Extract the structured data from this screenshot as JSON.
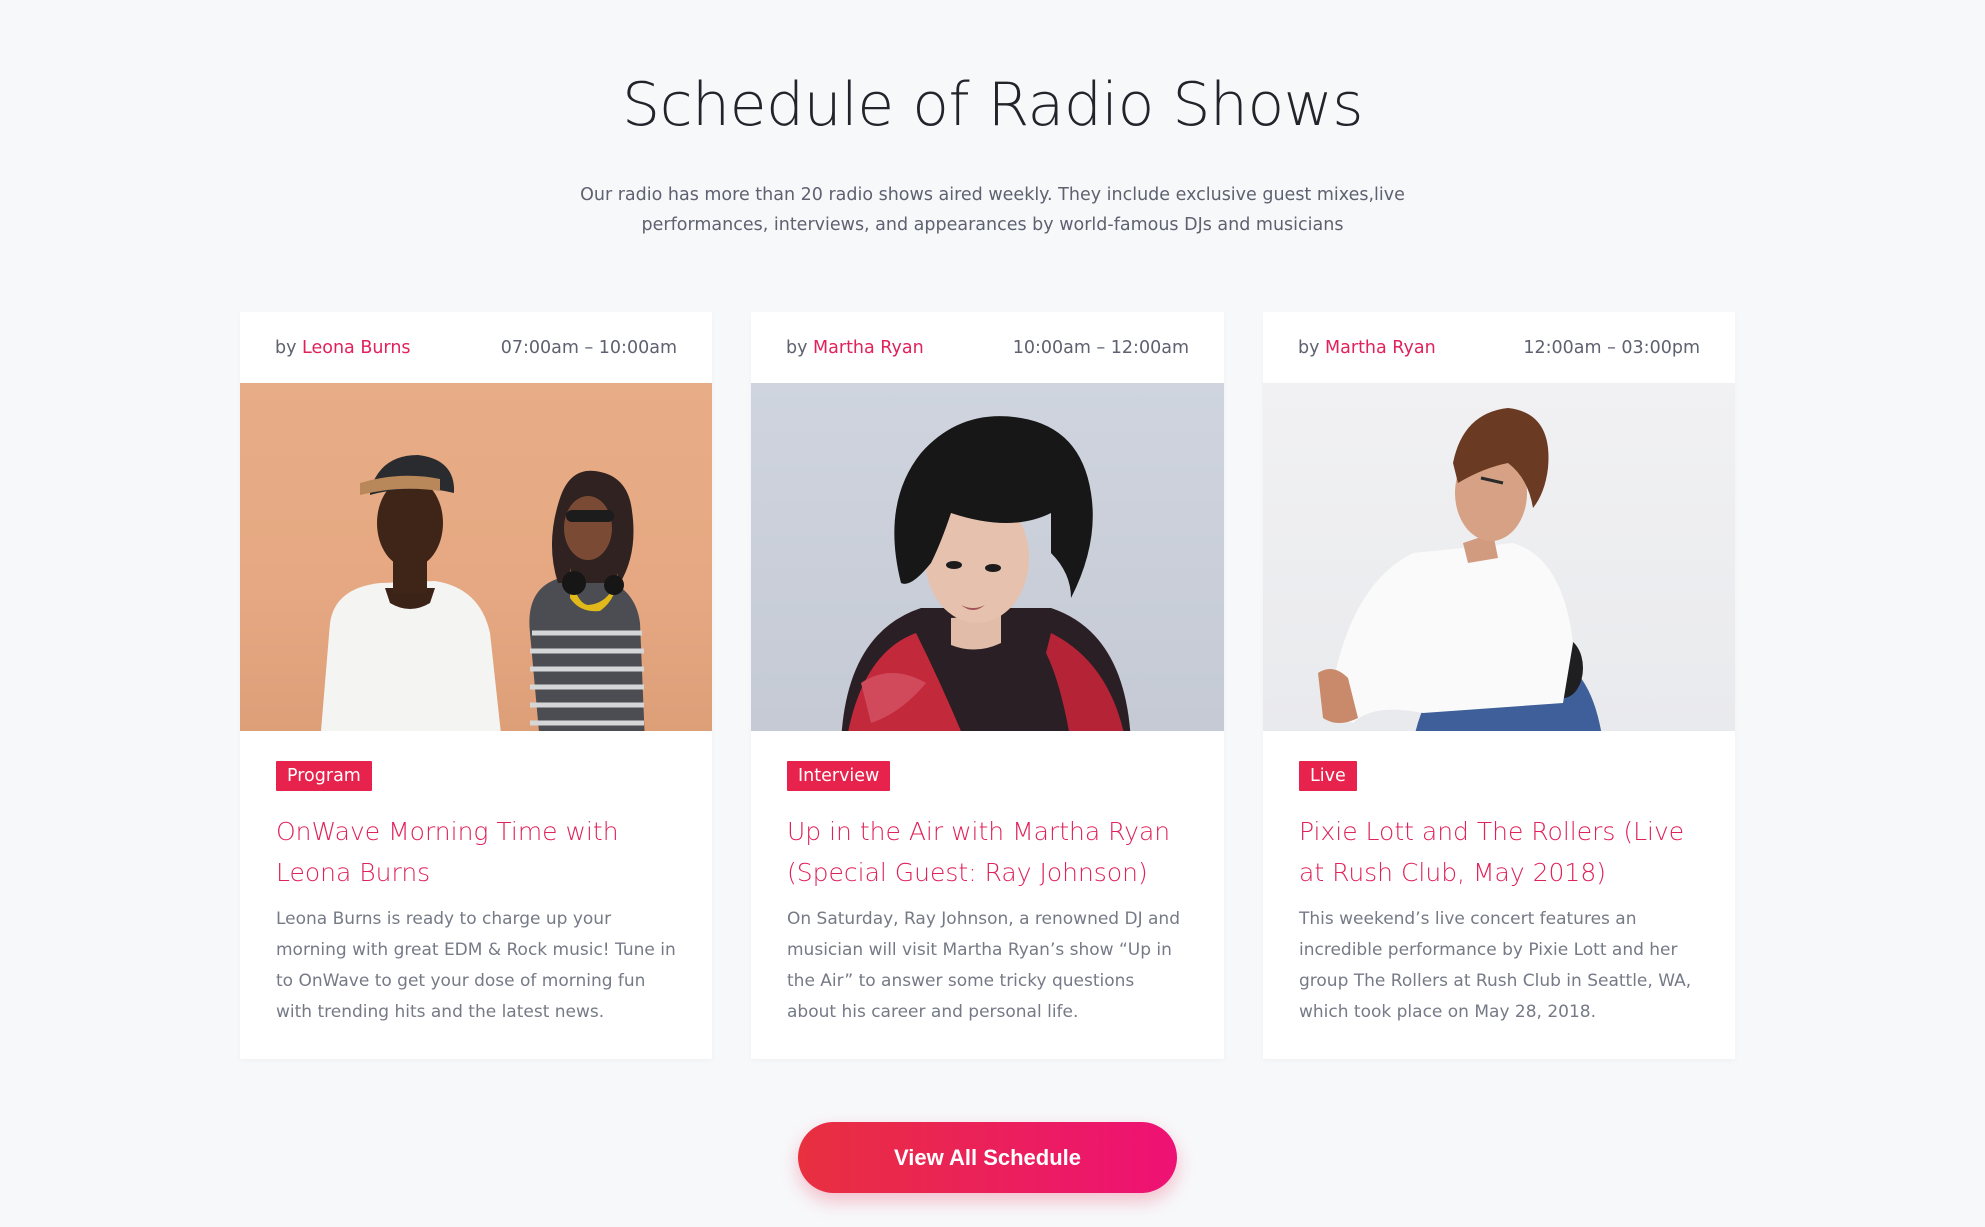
{
  "section": {
    "title": "Schedule of Radio Shows",
    "subtitle_line1": "Our radio has more than 20 radio shows aired weekly. They include exclusive guest mixes,live",
    "subtitle_line2": "performances, interviews, and appearances by world-famous DJs and musicians"
  },
  "cards": [
    {
      "by": "by",
      "host": "Leona Burns",
      "time": "07:00am – 10:00am",
      "badge": "Program",
      "title": "OnWave Morning Time with Leona Burns",
      "description": "Leona Burns is ready to charge up your morning with great EDM & Rock music! Tune in to OnWave to get your dose of morning fun with trending hits and the latest news."
    },
    {
      "by": "by",
      "host": "Martha Ryan",
      "time": "10:00am – 12:00am",
      "badge": "Interview",
      "title": "Up in the Air with Martha Ryan (Special Guest: Ray Johnson)",
      "description": "On Saturday, Ray Johnson, a renowned DJ and musician will visit Martha Ryan’s show “Up in the Air” to answer some tricky questions about his career and personal life."
    },
    {
      "by": "by",
      "host": "Martha Ryan",
      "time": "12:00am – 03:00pm",
      "badge": "Live",
      "title": "Pixie Lott and The Rollers (Live at Rush Club, May 2018)",
      "description": "This weekend’s live concert features an incredible performance by Pixie Lott and her group The Rollers at Rush Club in Seattle, WA, which took place on May 28, 2018."
    }
  ],
  "cta": {
    "label": "View All Schedule"
  },
  "colors": {
    "accent": "#e0215a",
    "badge": "#e7224c",
    "background": "#f7f8fa"
  }
}
